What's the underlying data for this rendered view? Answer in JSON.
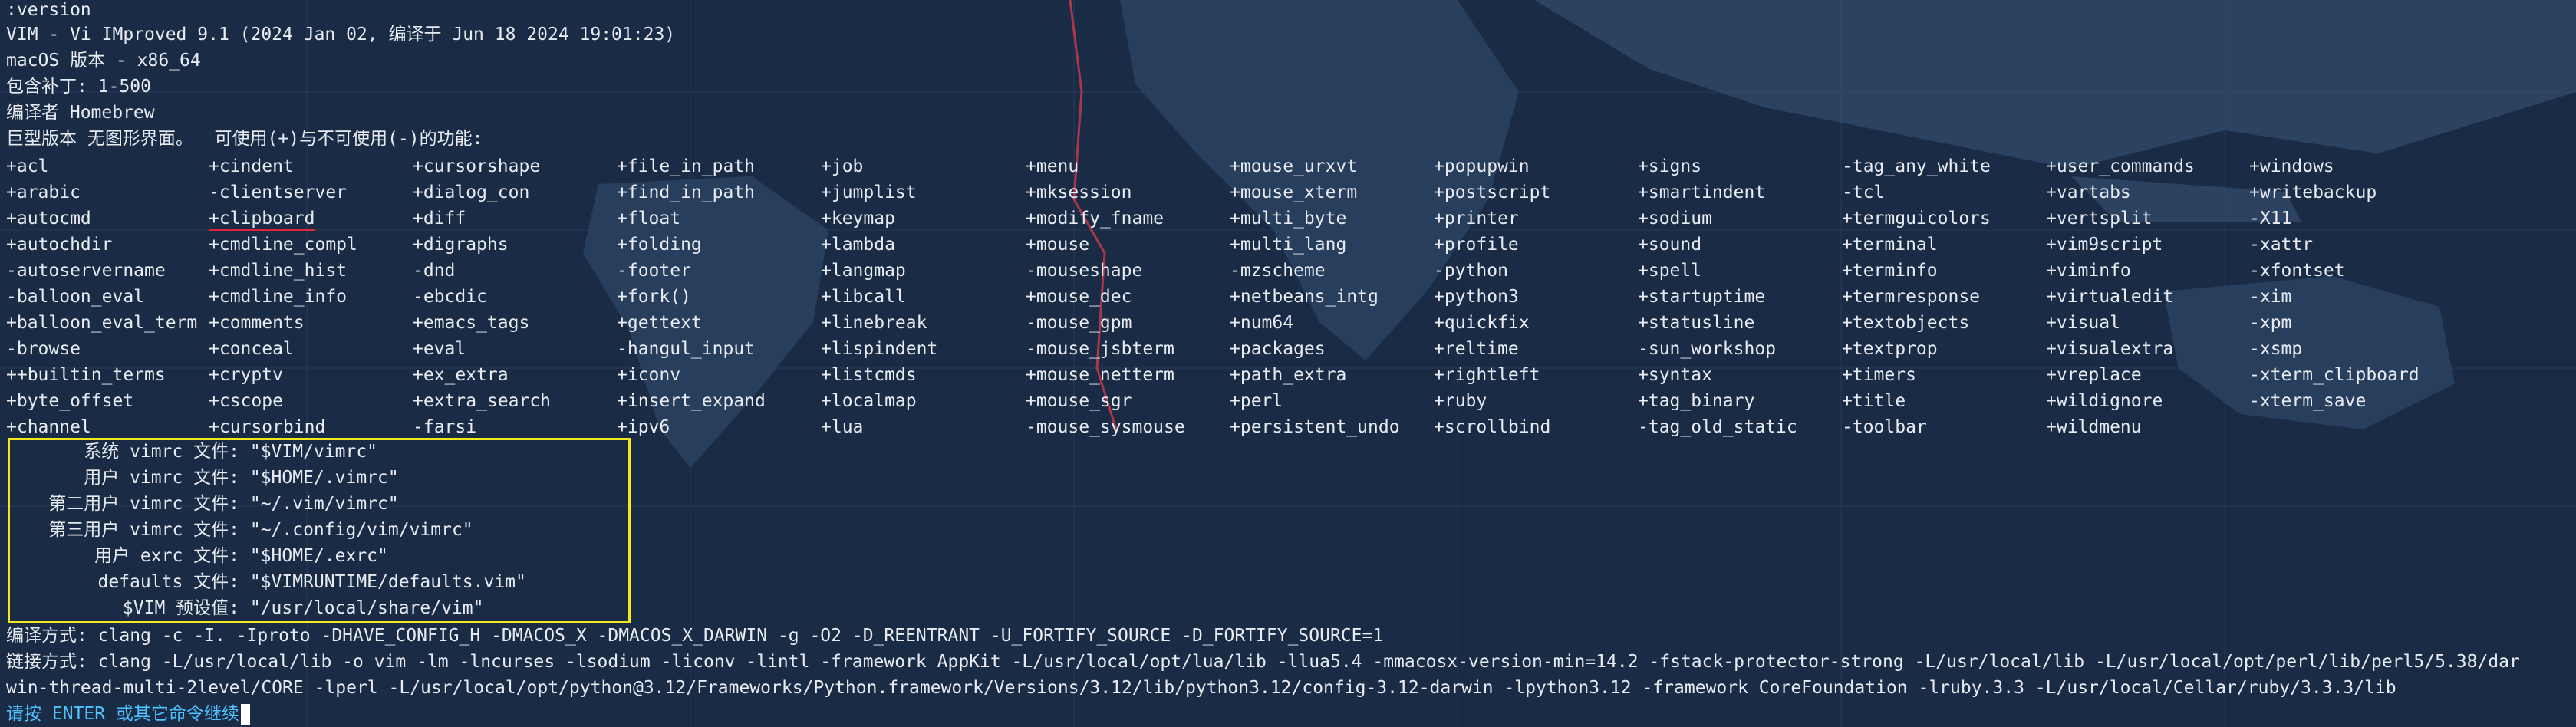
{
  "lines": {
    "cmd": ":version",
    "title": "VIM - Vi IMproved 9.1 (2024 Jan 02, 编译于 Jun 18 2024 19:01:23)",
    "platform": "macOS 版本 - x86_64",
    "patches": "包含补丁: 1-500",
    "compiled_by": "编译者 Homebrew",
    "features_intro": "巨型版本 无图形界面。  可使用(+)与不可使用(-)的功能:"
  },
  "features": [
    [
      "+acl",
      "+arabic",
      "+autocmd",
      "+autochdir",
      "-autoservername",
      "-balloon_eval",
      "+balloon_eval_term",
      "-browse",
      "++builtin_terms",
      "+byte_offset",
      "+channel"
    ],
    [
      "+cindent",
      "-clientserver",
      "+clipboard",
      "+cmdline_compl",
      "+cmdline_hist",
      "+cmdline_info",
      "+comments",
      "+conceal",
      "+cryptv",
      "+cscope",
      "+cursorbind"
    ],
    [
      "+cursorshape",
      "+dialog_con",
      "+diff",
      "+digraphs",
      "-dnd",
      "-ebcdic",
      "+emacs_tags",
      "+eval",
      "+ex_extra",
      "+extra_search",
      "-farsi"
    ],
    [
      "+file_in_path",
      "+find_in_path",
      "+float",
      "+folding",
      "-footer",
      "+fork()",
      "+gettext",
      "-hangul_input",
      "+iconv",
      "+insert_expand",
      "+ipv6"
    ],
    [
      "+job",
      "+jumplist",
      "+keymap",
      "+lambda",
      "+langmap",
      "+libcall",
      "+linebreak",
      "+lispindent",
      "+listcmds",
      "+localmap",
      "+lua"
    ],
    [
      "+menu",
      "+mksession",
      "+modify_fname",
      "+mouse",
      "-mouseshape",
      "+mouse_dec",
      "-mouse_gpm",
      "-mouse_jsbterm",
      "+mouse_netterm",
      "+mouse_sgr",
      "-mouse_sysmouse"
    ],
    [
      "+mouse_urxvt",
      "+mouse_xterm",
      "+multi_byte",
      "+multi_lang",
      "-mzscheme",
      "+netbeans_intg",
      "+num64",
      "+packages",
      "+path_extra",
      "+perl",
      "+persistent_undo"
    ],
    [
      "+popupwin",
      "+postscript",
      "+printer",
      "+profile",
      "-python",
      "+python3",
      "+quickfix",
      "+reltime",
      "+rightleft",
      "+ruby",
      "+scrollbind"
    ],
    [
      "+signs",
      "+smartindent",
      "+sodium",
      "+sound",
      "+spell",
      "+startuptime",
      "+statusline",
      "-sun_workshop",
      "+syntax",
      "+tag_binary",
      "-tag_old_static"
    ],
    [
      "-tag_any_white",
      "-tcl",
      "+termguicolors",
      "+terminal",
      "+terminfo",
      "+termresponse",
      "+textobjects",
      "+textprop",
      "+timers",
      "+title",
      "-toolbar"
    ],
    [
      "+user_commands",
      "+vartabs",
      "+vertsplit",
      "+vim9script",
      "+viminfo",
      "+virtualedit",
      "+visual",
      "+visualextra",
      "+vreplace",
      "+wildignore",
      "+wildmenu"
    ],
    [
      "+windows",
      "+writebackup",
      "-X11",
      "-xattr",
      "-xfontset",
      "-xim",
      "-xpm",
      "-xsmp",
      "-xterm_clipboard",
      "-xterm_save",
      ""
    ]
  ],
  "vimrc": [
    {
      "label": "系统 vimrc 文件:",
      "value": " \"$VIM/vimrc\""
    },
    {
      "label": "用户 vimrc 文件:",
      "value": " \"$HOME/.vimrc\""
    },
    {
      "label": "第二用户 vimrc 文件:",
      "value": " \"~/.vim/vimrc\""
    },
    {
      "label": "第三用户 vimrc 文件:",
      "value": " \"~/.config/vim/vimrc\""
    },
    {
      "label": "用户 exrc 文件:",
      "value": " \"$HOME/.exrc\""
    },
    {
      "label": "defaults 文件:",
      "value": " \"$VIMRUNTIME/defaults.vim\""
    },
    {
      "label": "$VIM 预设值:",
      "value": " \"/usr/local/share/vim\""
    }
  ],
  "compile": {
    "compile_line": "编译方式: clang -c -I. -Iproto -DHAVE_CONFIG_H -DMACOS_X -DMACOS_X_DARWIN -g -O2 -D_REENTRANT -U_FORTIFY_SOURCE -D_FORTIFY_SOURCE=1",
    "link_line_1": "链接方式: clang -L/usr/local/lib -o vim -lm -lncurses -lsodium -liconv -lintl -framework AppKit -L/usr/local/opt/lua/lib -llua5.4 -mmacosx-version-min=14.2 -fstack-protector-strong -L/usr/local/lib -L/usr/local/opt/perl/lib/perl5/5.38/dar",
    "link_line_2": "win-thread-multi-2level/CORE -lperl -L/usr/local/opt/python@3.12/Frameworks/Python.framework/Versions/3.12/lib/python3.12/config-3.12-darwin -lpython3.12 -framework CoreFoundation -lruby.3.3 -L/usr/local/Cellar/ruby/3.3.3/lib"
  },
  "prompt": "请按 ENTER 或其它命令继续",
  "colors": {
    "background": "#1a2b45",
    "text": "#e8ecf2",
    "prompt": "#4fc3ff",
    "highlight_box": "#f2e81b",
    "underline": "#e0233a"
  }
}
